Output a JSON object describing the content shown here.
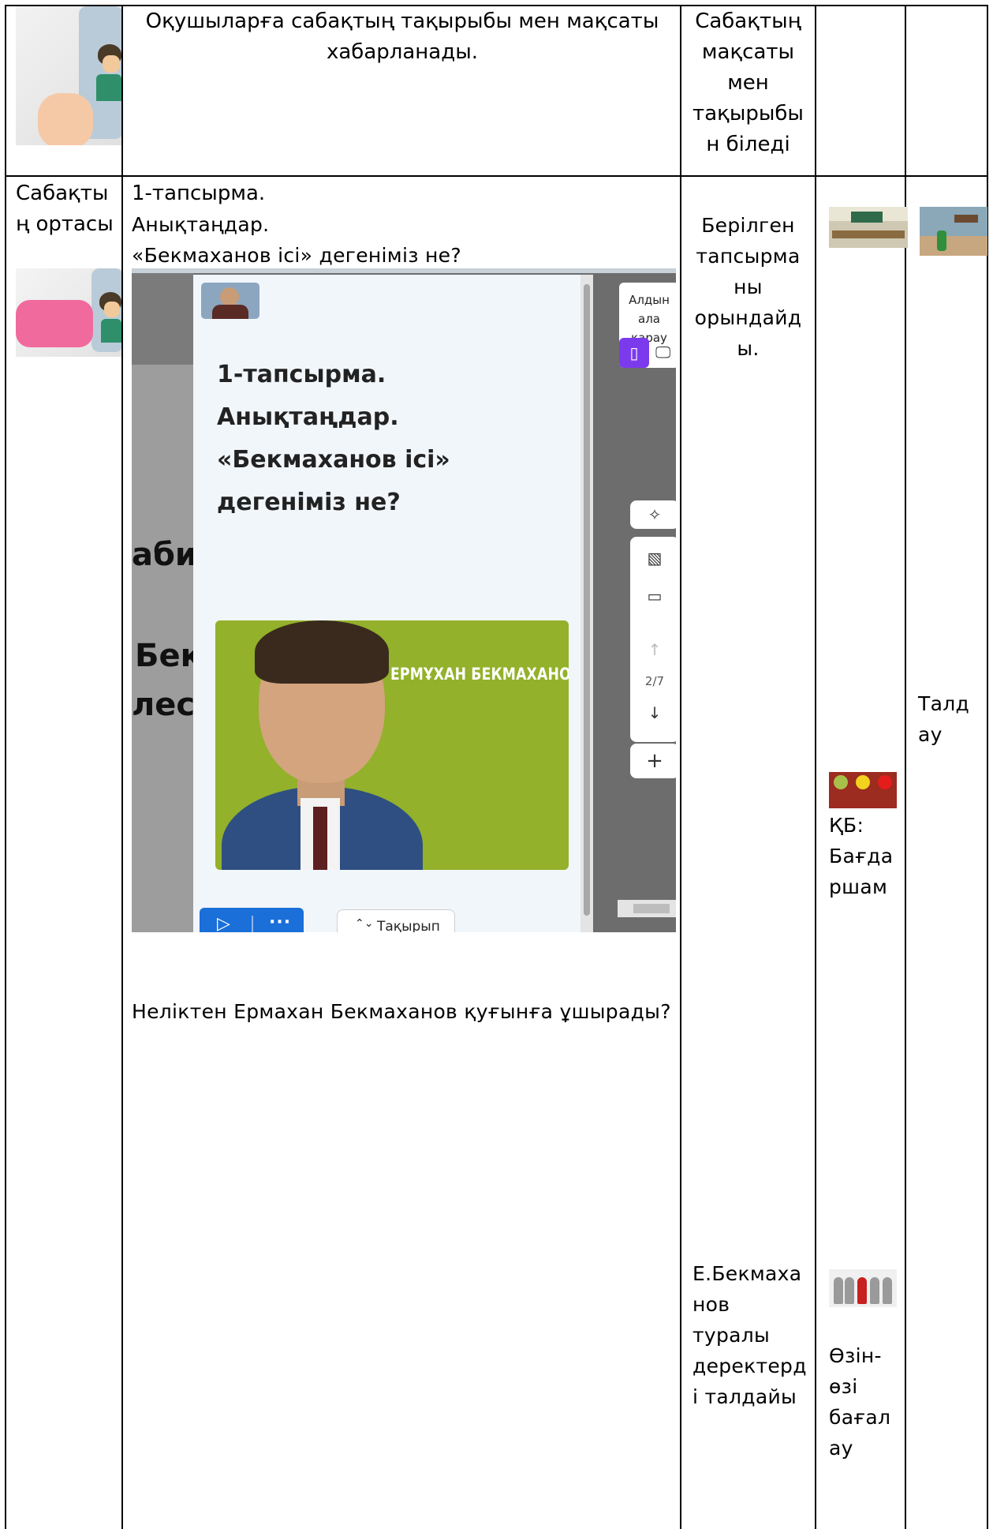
{
  "row1": {
    "activity": "Оқушыларға сабақтың тақырыбы мен мақсаты хабарланады.",
    "expected_lines": [
      "Сабақтың",
      "мақсаты",
      "мен",
      "тақырыбы",
      "н біледі"
    ]
  },
  "row2": {
    "stage_lines": [
      "Сабақты",
      "ң ортасы"
    ],
    "task_title": "1-тапсырма.",
    "task_lines": [
      "Анықтаңдар.",
      "«Бекмаханов ісі» дегеніміз не?"
    ],
    "question": "Неліктен Ермахан Бекмаханов қуғынға ұшырады?",
    "expected_1_lines": [
      "Берілген",
      "тапсырма",
      "ны",
      "орындайд",
      "ы."
    ],
    "expected_2_lines": [
      "Е.Бекмаха",
      "нов",
      "туралы",
      "деректерд",
      "і талдайы"
    ],
    "assessment_1_lines": [
      "ҚБ:",
      "Бағда",
      "ршам"
    ],
    "assessment_2_lines": [
      "Өзін-",
      "өзі",
      "бағал",
      "ау"
    ],
    "resources_lines": [
      "Талд",
      "ау"
    ]
  },
  "screenshot": {
    "slide_lines": [
      "1-тапсырма.",
      "Анықтаңдар.",
      "«Бекмаханов ісі»",
      "дегеніміз не?"
    ],
    "portrait_name": "ЕРМҰХАН БЕКМАХАНОВ",
    "preview_label_lines": [
      "Алдын",
      "ала",
      "қарау"
    ],
    "page_counter": "2/7",
    "topic_button": "Тақырып",
    "background_text": [
      "аби",
      "Бек",
      "лесі"
    ],
    "colors": {
      "accent_blue": "#1a6fd8",
      "accent_purple": "#7c3aed",
      "portrait_bg": "#93b12a"
    }
  },
  "icons": [
    "sparkle-icon",
    "image-icon",
    "comment-icon",
    "arrow-up-icon",
    "arrow-down-icon",
    "plus-icon",
    "phone-icon",
    "desktop-icon",
    "play-icon",
    "more-icon",
    "chevron-updown-icon"
  ]
}
